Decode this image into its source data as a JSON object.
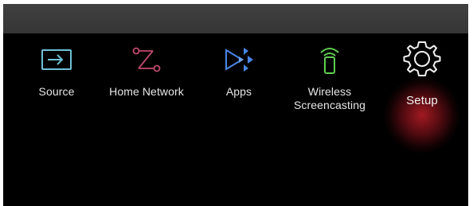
{
  "menu": {
    "items": [
      {
        "label": "Source",
        "icon": "source-input-icon"
      },
      {
        "label": "Home Network",
        "icon": "home-network-icon"
      },
      {
        "label": "Apps",
        "icon": "apps-icon"
      },
      {
        "label_line1": "Wireless",
        "label_line2": "Screencasting",
        "icon": "wireless-screencasting-icon"
      },
      {
        "label": "Setup",
        "icon": "gear-icon",
        "selected": true
      }
    ]
  },
  "colors": {
    "background": "#000000",
    "top_bar": "#3a3a3a",
    "source_icon": "#6ec1d6",
    "home_network_icon": "#c04a6e",
    "apps_icon": "#4a86e8",
    "wireless_icon": "#5fcf4f",
    "setup_highlight": "#b31e28",
    "label_text": "#e6e6e6"
  }
}
